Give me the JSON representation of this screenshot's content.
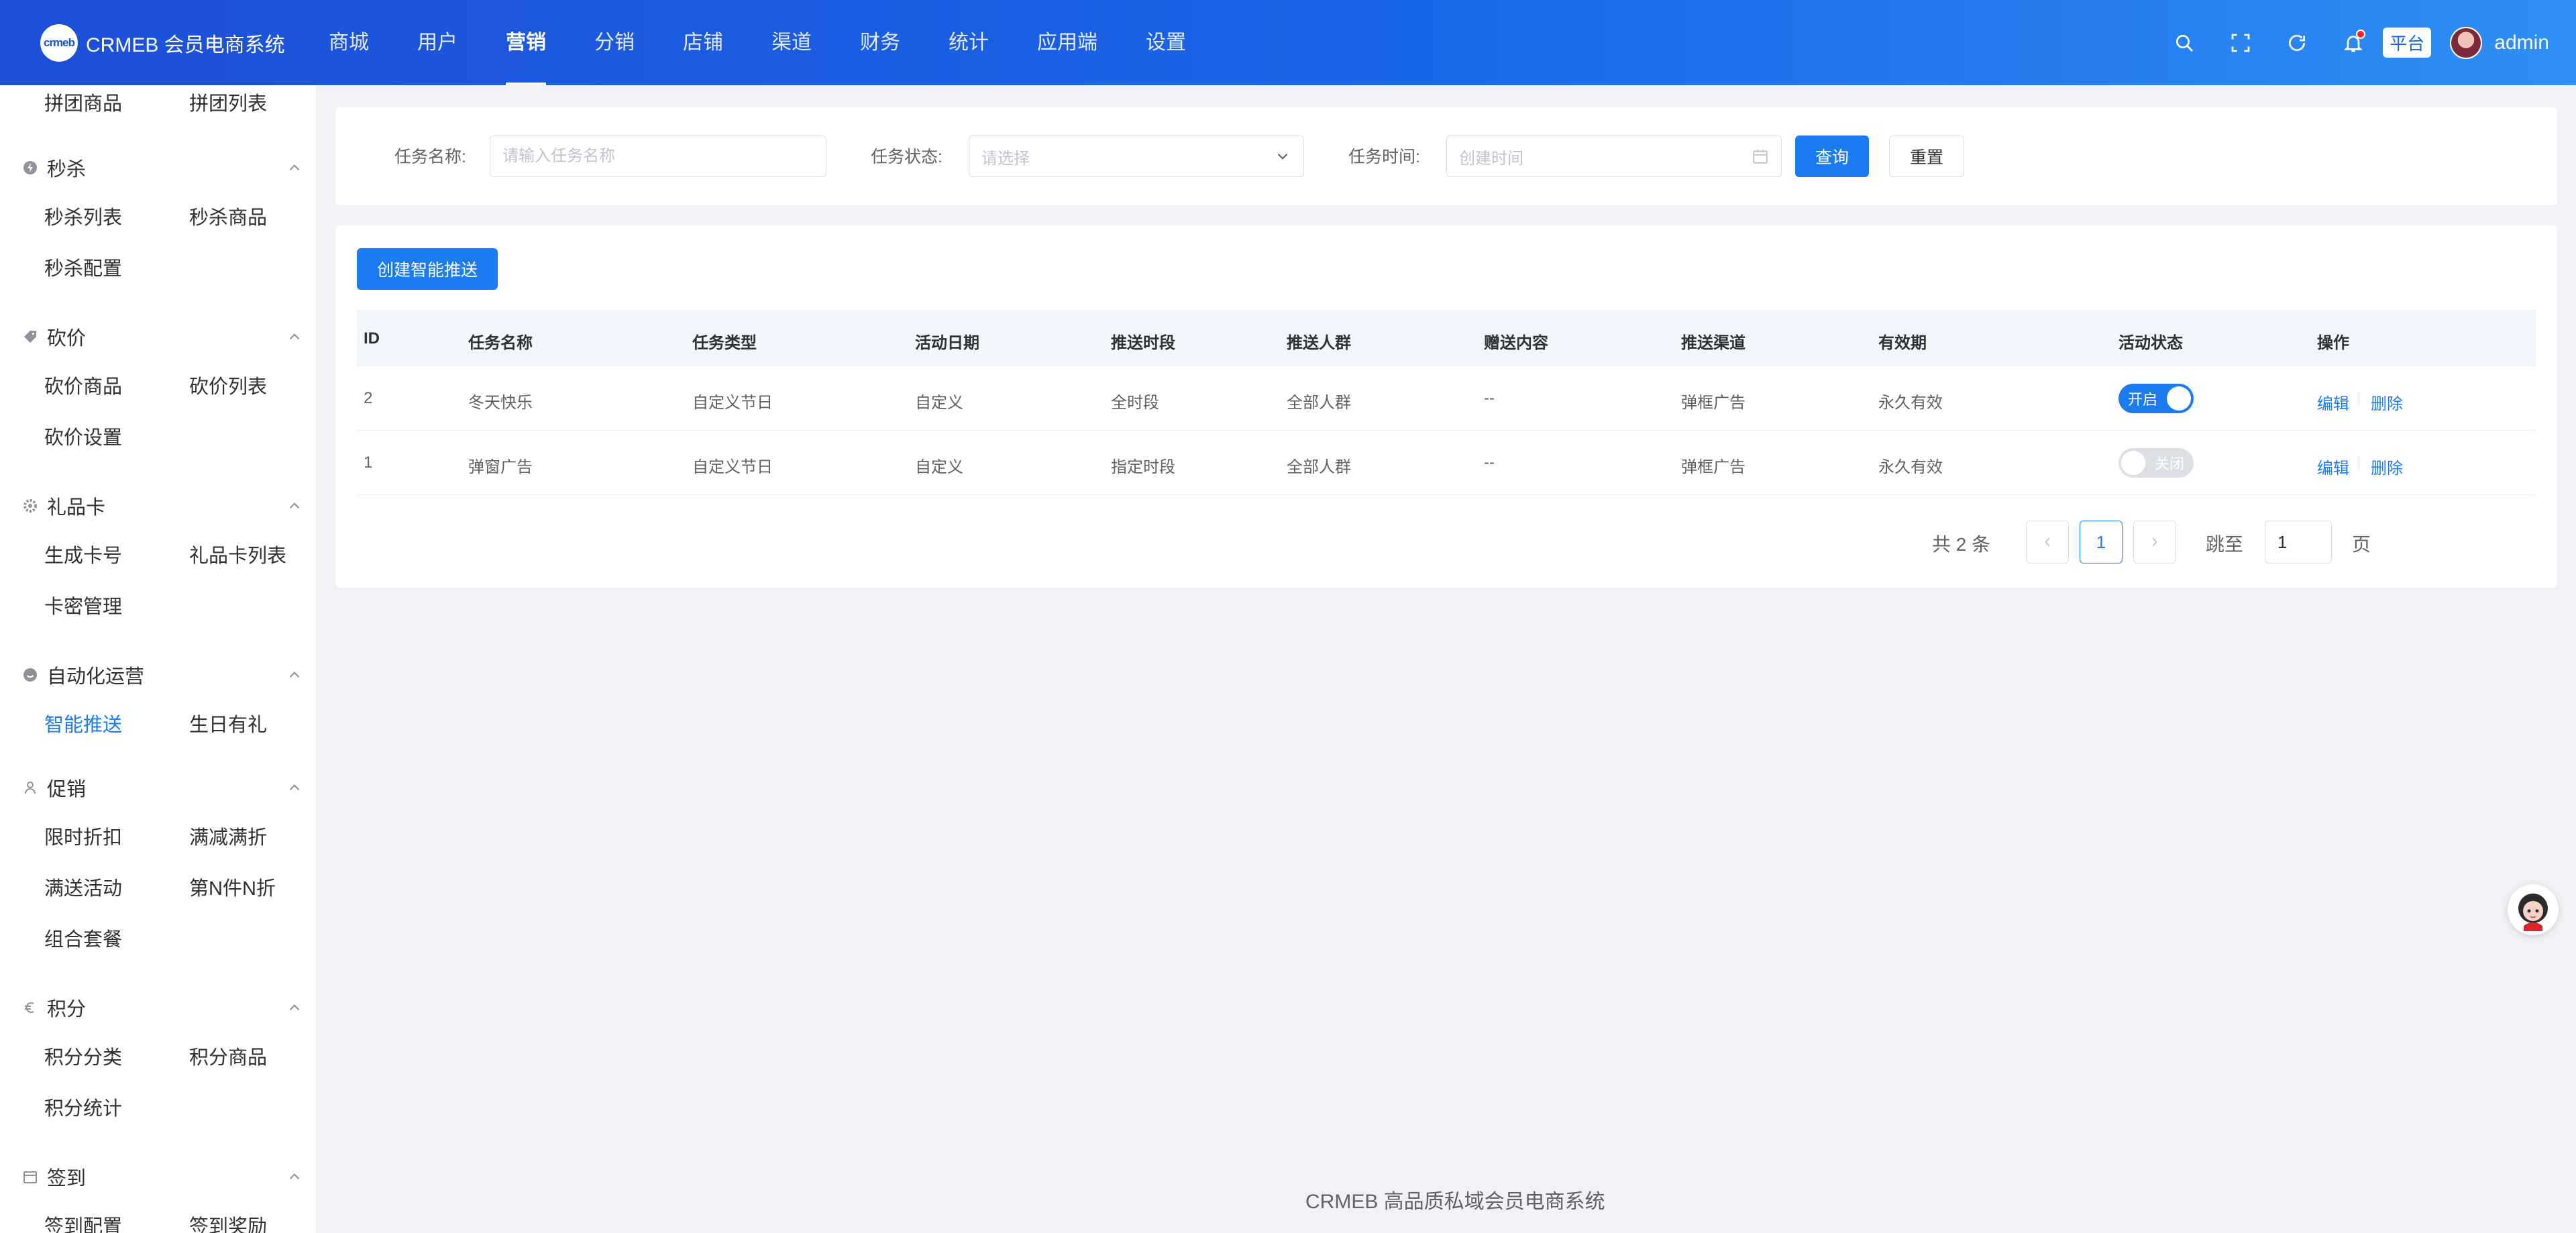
{
  "header": {
    "logo_mark": "crmeb",
    "logo_title": "CRMEB 会员电商系统",
    "nav": [
      "商城",
      "用户",
      "营销",
      "分销",
      "店铺",
      "渠道",
      "财务",
      "统计",
      "应用端",
      "设置"
    ],
    "active_nav": "营销",
    "platform_badge": "平台",
    "username": "admin",
    "icons": [
      "search-icon",
      "fullscreen-icon",
      "refresh-icon",
      "bell-icon"
    ]
  },
  "sidebar": {
    "top_items": [
      "拼团商品",
      "拼团列表"
    ],
    "groups": [
      {
        "title": "秒杀",
        "icon": "flash-icon",
        "items": [
          "秒杀列表",
          "秒杀商品",
          "秒杀配置"
        ]
      },
      {
        "title": "砍价",
        "icon": "tag-icon",
        "items": [
          "砍价商品",
          "砍价列表",
          "砍价设置"
        ]
      },
      {
        "title": "礼品卡",
        "icon": "gear-icon",
        "items": [
          "生成卡号",
          "礼品卡列表",
          "卡密管理"
        ]
      },
      {
        "title": "自动化运营",
        "icon": "smile-icon",
        "items": [
          "智能推送",
          "生日有礼"
        ]
      },
      {
        "title": "促销",
        "icon": "person-icon",
        "items": [
          "限时折扣",
          "满减满折",
          "满送活动",
          "第N件N折",
          "组合套餐"
        ]
      },
      {
        "title": "积分",
        "icon": "euro-icon",
        "items": [
          "积分分类",
          "积分商品",
          "积分统计"
        ]
      },
      {
        "title": "签到",
        "icon": "calendar-icon",
        "items": [
          "签到配置",
          "签到奖励"
        ]
      }
    ],
    "active_item": "智能推送"
  },
  "filters": {
    "name_label": "任务名称:",
    "name_placeholder": "请输入任务名称",
    "status_label": "任务状态:",
    "status_placeholder": "请选择",
    "time_label": "任务时间:",
    "time_placeholder": "创建时间",
    "query_button": "查询",
    "reset_button": "重置"
  },
  "table": {
    "create_button": "创建智能推送",
    "columns": [
      "ID",
      "任务名称",
      "任务类型",
      "活动日期",
      "推送时段",
      "推送人群",
      "赠送内容",
      "推送渠道",
      "有效期",
      "活动状态",
      "操作"
    ],
    "rows": [
      {
        "id": "2",
        "name": "冬天快乐",
        "type": "自定义节日",
        "date": "自定义",
        "period": "全时段",
        "audience": "全部人群",
        "gift": "--",
        "channel": "弹框广告",
        "validity": "永久有效",
        "status_on": true,
        "status_text": "开启"
      },
      {
        "id": "1",
        "name": "弹窗广告",
        "type": "自定义节日",
        "date": "自定义",
        "period": "指定时段",
        "audience": "全部人群",
        "gift": "--",
        "channel": "弹框广告",
        "validity": "永久有效",
        "status_on": false,
        "status_text": "关闭"
      }
    ],
    "edit_label": "编辑",
    "delete_label": "删除"
  },
  "pagination": {
    "total_text": "共 2 条",
    "current_page": "1",
    "jump_label": "跳至",
    "jump_value": "1",
    "page_unit": "页"
  },
  "footer": "CRMEB 高品质私域会员电商系统",
  "colors": {
    "primary": "#1a7cf0",
    "header_start": "#1d4fd8",
    "header_end": "#2f8ff5",
    "page_bg": "#f0f2f5"
  }
}
